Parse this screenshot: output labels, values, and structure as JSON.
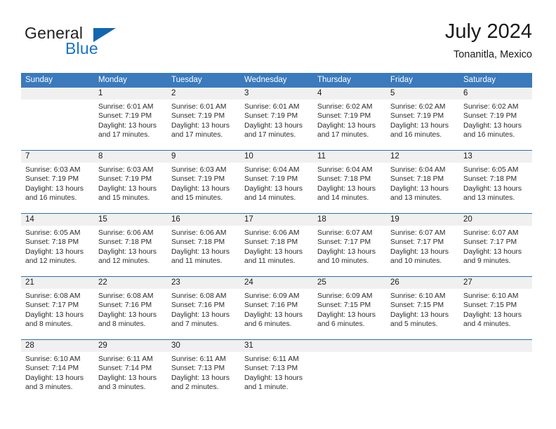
{
  "brand": {
    "word1": "General",
    "word2": "Blue",
    "triangle_color": "#1266b0",
    "word2_color": "#1a74c4"
  },
  "header": {
    "month_title": "July 2024",
    "location": "Tonanitla, Mexico"
  },
  "theme": {
    "header_blue": "#3a7abd",
    "row_separator": "#2f6fb5",
    "day_band_gray": "#f0f0f0"
  },
  "calendar": {
    "weekday_headers": [
      "Sunday",
      "Monday",
      "Tuesday",
      "Wednesday",
      "Thursday",
      "Friday",
      "Saturday"
    ],
    "weeks": [
      [
        {
          "day": "",
          "empty": true,
          "sunrise": "",
          "sunset": "",
          "daylight": ""
        },
        {
          "day": "1",
          "sunrise": "Sunrise: 6:01 AM",
          "sunset": "Sunset: 7:19 PM",
          "daylight": "Daylight: 13 hours and 17 minutes."
        },
        {
          "day": "2",
          "sunrise": "Sunrise: 6:01 AM",
          "sunset": "Sunset: 7:19 PM",
          "daylight": "Daylight: 13 hours and 17 minutes."
        },
        {
          "day": "3",
          "sunrise": "Sunrise: 6:01 AM",
          "sunset": "Sunset: 7:19 PM",
          "daylight": "Daylight: 13 hours and 17 minutes."
        },
        {
          "day": "4",
          "sunrise": "Sunrise: 6:02 AM",
          "sunset": "Sunset: 7:19 PM",
          "daylight": "Daylight: 13 hours and 17 minutes."
        },
        {
          "day": "5",
          "sunrise": "Sunrise: 6:02 AM",
          "sunset": "Sunset: 7:19 PM",
          "daylight": "Daylight: 13 hours and 16 minutes."
        },
        {
          "day": "6",
          "sunrise": "Sunrise: 6:02 AM",
          "sunset": "Sunset: 7:19 PM",
          "daylight": "Daylight: 13 hours and 16 minutes."
        }
      ],
      [
        {
          "day": "7",
          "sunrise": "Sunrise: 6:03 AM",
          "sunset": "Sunset: 7:19 PM",
          "daylight": "Daylight: 13 hours and 16 minutes."
        },
        {
          "day": "8",
          "sunrise": "Sunrise: 6:03 AM",
          "sunset": "Sunset: 7:19 PM",
          "daylight": "Daylight: 13 hours and 15 minutes."
        },
        {
          "day": "9",
          "sunrise": "Sunrise: 6:03 AM",
          "sunset": "Sunset: 7:19 PM",
          "daylight": "Daylight: 13 hours and 15 minutes."
        },
        {
          "day": "10",
          "sunrise": "Sunrise: 6:04 AM",
          "sunset": "Sunset: 7:19 PM",
          "daylight": "Daylight: 13 hours and 14 minutes."
        },
        {
          "day": "11",
          "sunrise": "Sunrise: 6:04 AM",
          "sunset": "Sunset: 7:18 PM",
          "daylight": "Daylight: 13 hours and 14 minutes."
        },
        {
          "day": "12",
          "sunrise": "Sunrise: 6:04 AM",
          "sunset": "Sunset: 7:18 PM",
          "daylight": "Daylight: 13 hours and 13 minutes."
        },
        {
          "day": "13",
          "sunrise": "Sunrise: 6:05 AM",
          "sunset": "Sunset: 7:18 PM",
          "daylight": "Daylight: 13 hours and 13 minutes."
        }
      ],
      [
        {
          "day": "14",
          "sunrise": "Sunrise: 6:05 AM",
          "sunset": "Sunset: 7:18 PM",
          "daylight": "Daylight: 13 hours and 12 minutes."
        },
        {
          "day": "15",
          "sunrise": "Sunrise: 6:06 AM",
          "sunset": "Sunset: 7:18 PM",
          "daylight": "Daylight: 13 hours and 12 minutes."
        },
        {
          "day": "16",
          "sunrise": "Sunrise: 6:06 AM",
          "sunset": "Sunset: 7:18 PM",
          "daylight": "Daylight: 13 hours and 11 minutes."
        },
        {
          "day": "17",
          "sunrise": "Sunrise: 6:06 AM",
          "sunset": "Sunset: 7:18 PM",
          "daylight": "Daylight: 13 hours and 11 minutes."
        },
        {
          "day": "18",
          "sunrise": "Sunrise: 6:07 AM",
          "sunset": "Sunset: 7:17 PM",
          "daylight": "Daylight: 13 hours and 10 minutes."
        },
        {
          "day": "19",
          "sunrise": "Sunrise: 6:07 AM",
          "sunset": "Sunset: 7:17 PM",
          "daylight": "Daylight: 13 hours and 10 minutes."
        },
        {
          "day": "20",
          "sunrise": "Sunrise: 6:07 AM",
          "sunset": "Sunset: 7:17 PM",
          "daylight": "Daylight: 13 hours and 9 minutes."
        }
      ],
      [
        {
          "day": "21",
          "sunrise": "Sunrise: 6:08 AM",
          "sunset": "Sunset: 7:17 PM",
          "daylight": "Daylight: 13 hours and 8 minutes."
        },
        {
          "day": "22",
          "sunrise": "Sunrise: 6:08 AM",
          "sunset": "Sunset: 7:16 PM",
          "daylight": "Daylight: 13 hours and 8 minutes."
        },
        {
          "day": "23",
          "sunrise": "Sunrise: 6:08 AM",
          "sunset": "Sunset: 7:16 PM",
          "daylight": "Daylight: 13 hours and 7 minutes."
        },
        {
          "day": "24",
          "sunrise": "Sunrise: 6:09 AM",
          "sunset": "Sunset: 7:16 PM",
          "daylight": "Daylight: 13 hours and 6 minutes."
        },
        {
          "day": "25",
          "sunrise": "Sunrise: 6:09 AM",
          "sunset": "Sunset: 7:15 PM",
          "daylight": "Daylight: 13 hours and 6 minutes."
        },
        {
          "day": "26",
          "sunrise": "Sunrise: 6:10 AM",
          "sunset": "Sunset: 7:15 PM",
          "daylight": "Daylight: 13 hours and 5 minutes."
        },
        {
          "day": "27",
          "sunrise": "Sunrise: 6:10 AM",
          "sunset": "Sunset: 7:15 PM",
          "daylight": "Daylight: 13 hours and 4 minutes."
        }
      ],
      [
        {
          "day": "28",
          "sunrise": "Sunrise: 6:10 AM",
          "sunset": "Sunset: 7:14 PM",
          "daylight": "Daylight: 13 hours and 3 minutes."
        },
        {
          "day": "29",
          "sunrise": "Sunrise: 6:11 AM",
          "sunset": "Sunset: 7:14 PM",
          "daylight": "Daylight: 13 hours and 3 minutes."
        },
        {
          "day": "30",
          "sunrise": "Sunrise: 6:11 AM",
          "sunset": "Sunset: 7:13 PM",
          "daylight": "Daylight: 13 hours and 2 minutes."
        },
        {
          "day": "31",
          "sunrise": "Sunrise: 6:11 AM",
          "sunset": "Sunset: 7:13 PM",
          "daylight": "Daylight: 13 hours and 1 minute."
        },
        {
          "day": "",
          "empty": true,
          "sunrise": "",
          "sunset": "",
          "daylight": ""
        },
        {
          "day": "",
          "empty": true,
          "sunrise": "",
          "sunset": "",
          "daylight": ""
        },
        {
          "day": "",
          "empty": true,
          "sunrise": "",
          "sunset": "",
          "daylight": ""
        }
      ]
    ]
  }
}
